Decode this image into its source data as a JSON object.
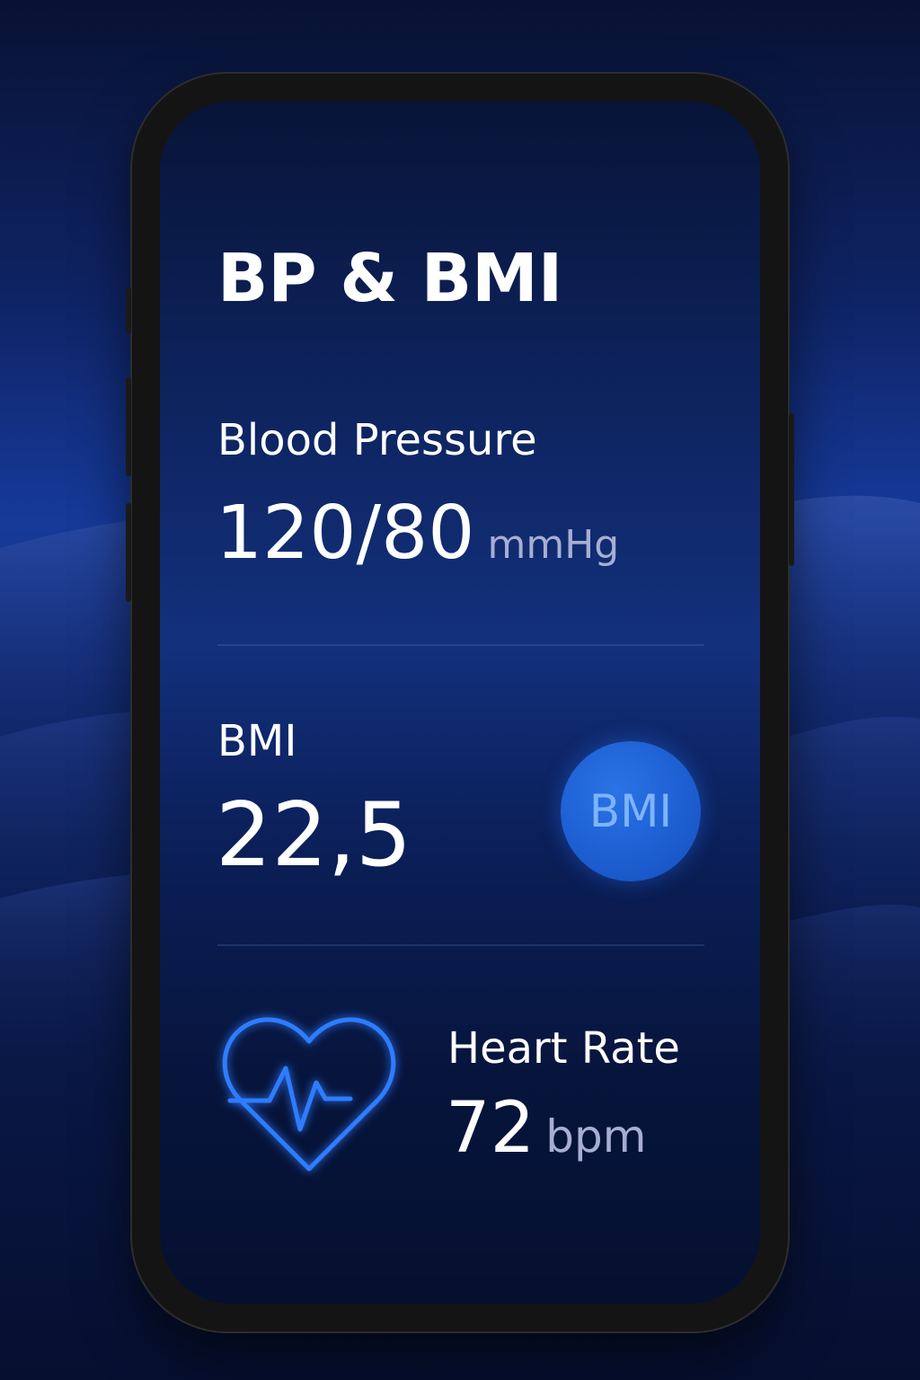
{
  "screen": {
    "title": "BP & BMI"
  },
  "blood_pressure": {
    "label": "Blood Pressure",
    "value": "120/80",
    "unit": "mmHg"
  },
  "bmi": {
    "label": "BMI",
    "value": "22,5",
    "badge": "BMI"
  },
  "heart_rate": {
    "label": "Heart Rate",
    "value": "72",
    "unit": "bpm",
    "icon": "heart-pulse-icon"
  },
  "colors": {
    "accent": "#1c5dd0",
    "heart_stroke": "#2f7cff",
    "unit_text": "#a7aed2",
    "background": "#0d225a"
  }
}
